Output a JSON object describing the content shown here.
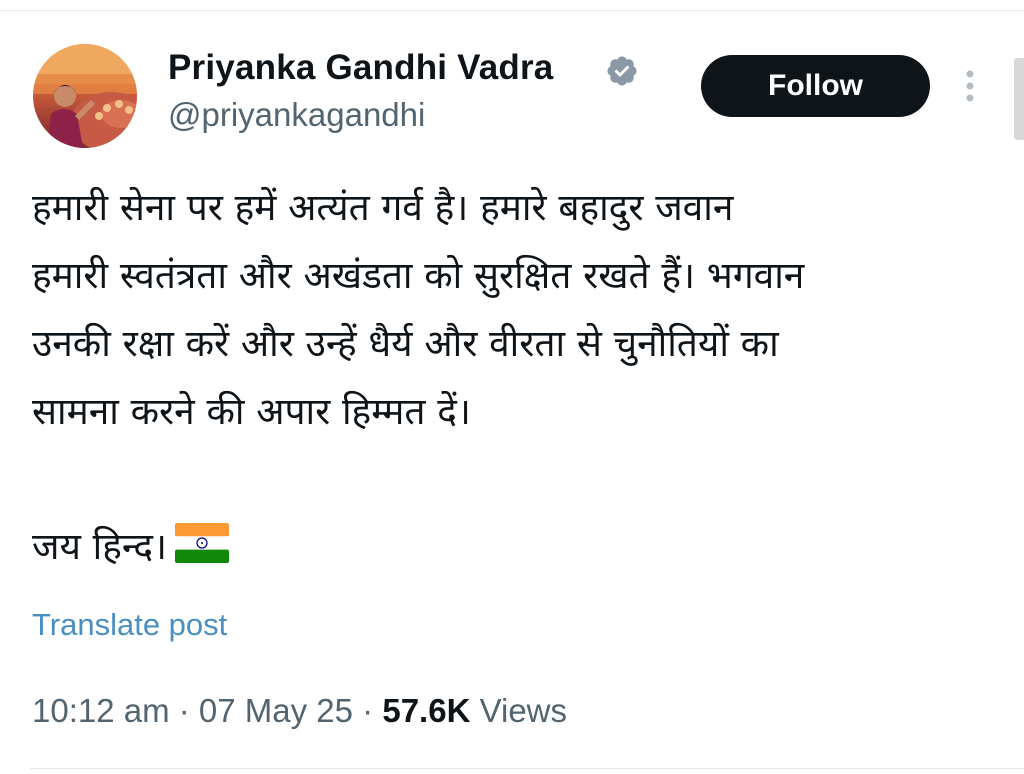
{
  "author": {
    "display_name": "Priyanka Gandhi Vadra",
    "handle": "@priyankagandhi",
    "verified_icon": "verified-badge-icon"
  },
  "actions": {
    "follow_label": "Follow",
    "more_icon": "vertical-ellipsis-icon"
  },
  "tweet": {
    "lines": [
      "हमारी सेना पर हमें अत्यंत गर्व है। हमारे बहादुर जवान",
      "हमारी स्वतंत्रता और अखंडता को सुरक्षित रखते हैं। भगवान",
      "उनकी रक्षा करें और उन्हें धैर्य और वीरता से चुनौतियों का",
      "सामना करने की अपार हिम्मत दें।",
      "जय हिन्द।"
    ],
    "emoji": "india-flag-icon"
  },
  "translate_label": "Translate post",
  "meta": {
    "time": "10:12 am",
    "sep1": " · ",
    "date": "07 May 25",
    "sep2": " · ",
    "views_count": "57.6K",
    "views_label": " Views"
  },
  "colors": {
    "link": "#4a8fc0",
    "follow_bg": "#0f1419",
    "verified": "#8b98a5",
    "muted_text": "#536471"
  }
}
